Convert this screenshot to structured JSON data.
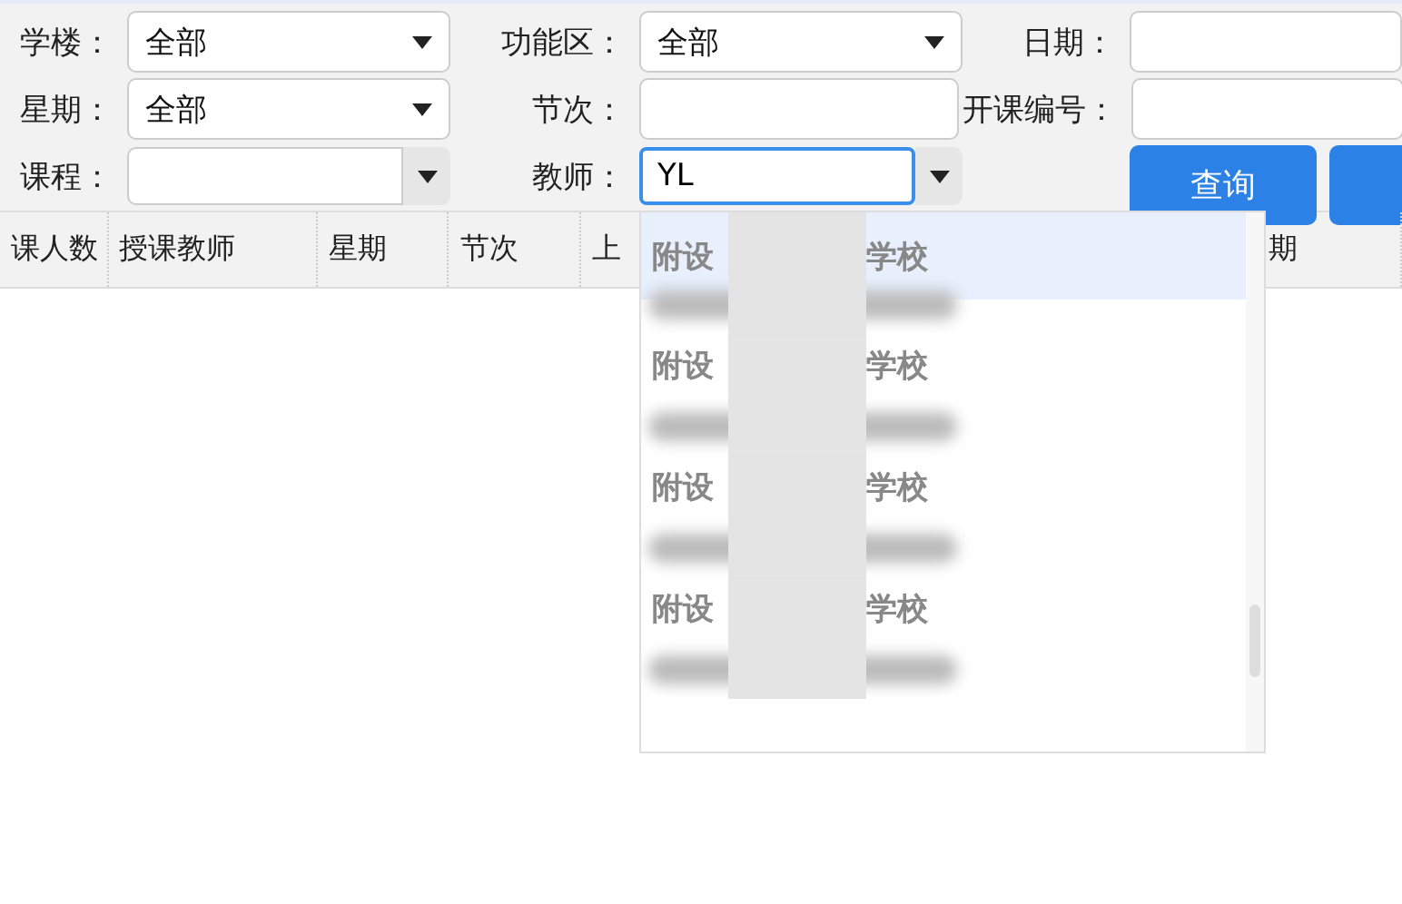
{
  "filters": [
    {
      "label": "学楼：",
      "kind": "select",
      "value": "全部"
    },
    {
      "label": "功能区：",
      "kind": "select",
      "value": "全部"
    },
    {
      "label": "日期：",
      "kind": "text"
    },
    {
      "label": "星期：",
      "kind": "select",
      "value": "全部"
    },
    {
      "label": "节次：",
      "kind": "text"
    },
    {
      "label": "开课编号：",
      "kind": "text"
    },
    {
      "label": "课程：",
      "kind": "combo"
    },
    {
      "label": "教师：",
      "kind": "combo",
      "value": "YL",
      "focused": true
    },
    {
      "kind": "buttons",
      "buttons": [
        "查询"
      ]
    }
  ],
  "table": {
    "columns": [
      "课人数",
      "授课教师",
      "星期",
      "节次",
      "上",
      "期"
    ]
  },
  "dropdown": {
    "items": [
      {
        "prefix": "附设",
        "suffix": "学校",
        "selected": true
      },
      {
        "prefix": "附设",
        "suffix": "学校",
        "selected": false
      },
      {
        "prefix": "附设",
        "suffix": "学校",
        "selected": false
      },
      {
        "prefix": "附设",
        "suffix": "学校",
        "selected": false
      }
    ]
  }
}
